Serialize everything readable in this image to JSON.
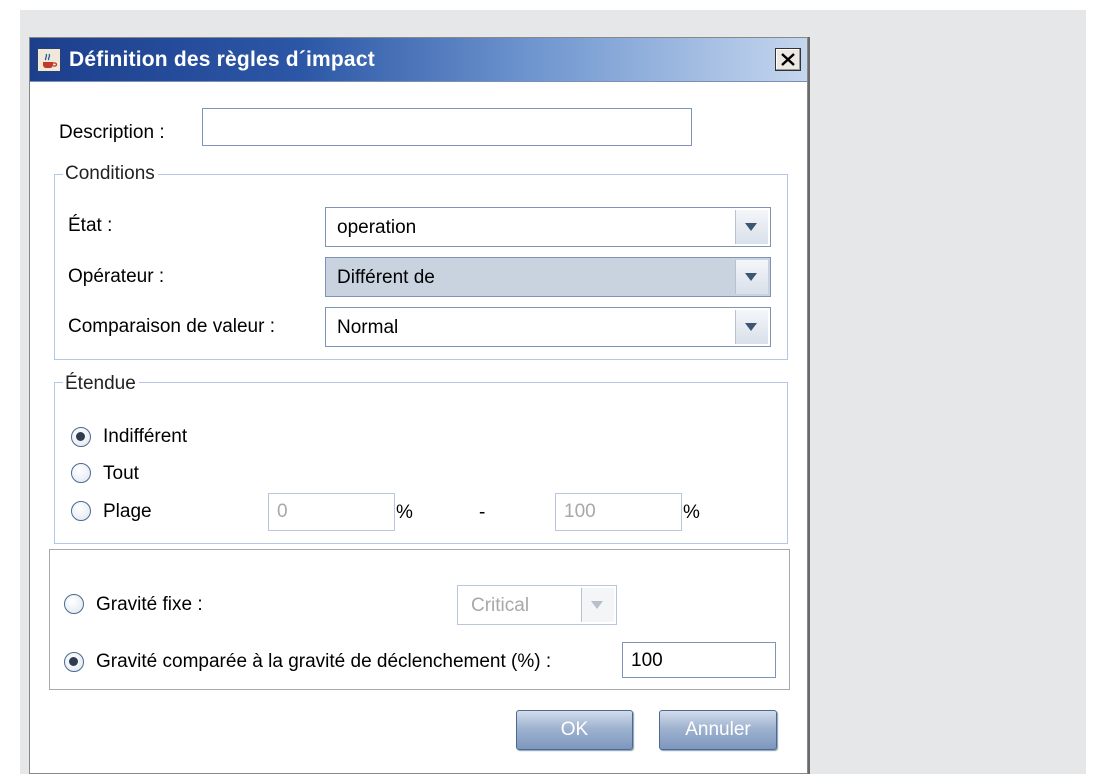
{
  "dialog": {
    "title": "Définition des règles d´impact",
    "description_label": "Description :",
    "description_value": ""
  },
  "conditions": {
    "group_title": "Conditions",
    "etat_label": "État :",
    "etat_value": "operation",
    "operateur_label": "Opérateur :",
    "operateur_value": "Différent de",
    "comparaison_label": "Comparaison de valeur :",
    "comparaison_value": "Normal"
  },
  "etendue": {
    "group_title": "Étendue",
    "options": [
      "Indifférent",
      "Tout",
      "Plage"
    ],
    "selected": "Indifférent",
    "range_from": "0",
    "range_to": "100",
    "percent": "%",
    "dash": "-"
  },
  "gravite": {
    "fixe_label": "Gravité fixe :",
    "fixe_value": "Critical",
    "comparee_label": "Gravité comparée à la gravité de déclenchement (%) :",
    "comparee_value": "100",
    "selected": "comparee"
  },
  "buttons": {
    "ok": "OK",
    "cancel": "Annuler"
  },
  "icons": [
    "java-cup-icon",
    "close-icon",
    "chevron-down-icon"
  ]
}
